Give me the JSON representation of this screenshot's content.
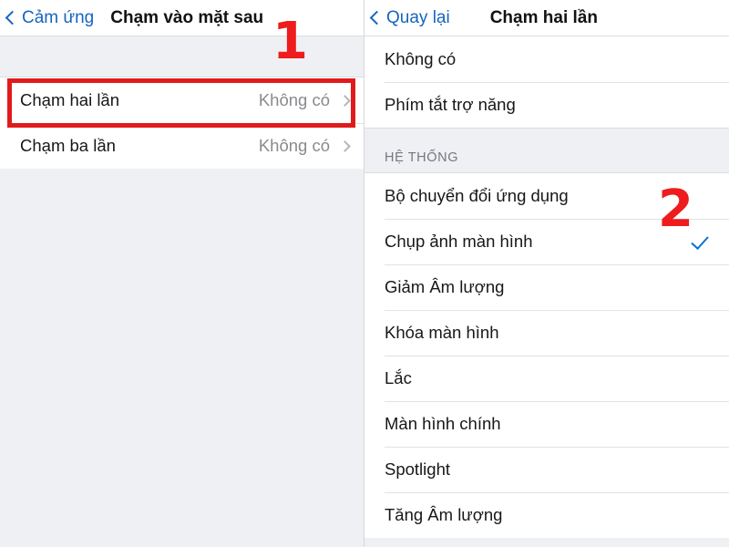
{
  "left_panel": {
    "navbar": {
      "back_label": "Cảm ứng",
      "back_icon": "chevron-left-icon",
      "title": "Chạm vào mặt sau"
    },
    "rows": [
      {
        "label": "Chạm hai lần",
        "value": "Không có",
        "chevron": "chevron-right-icon",
        "highlighted": true
      },
      {
        "label": "Chạm ba lần",
        "value": "Không có",
        "chevron": "chevron-right-icon",
        "highlighted": false
      }
    ]
  },
  "right_panel": {
    "navbar": {
      "back_label": "Quay lại",
      "back_icon": "chevron-left-icon",
      "title": "Chạm hai lần"
    },
    "top_rows": [
      {
        "label": "Không có",
        "selected": false
      },
      {
        "label": "Phím tắt trợ năng",
        "selected": false
      }
    ],
    "section_title": "HỆ THỐNG",
    "system_rows": [
      {
        "label": "Bộ chuyển đổi ứng dụng",
        "selected": false
      },
      {
        "label": "Chụp ảnh màn hình",
        "selected": true
      },
      {
        "label": "Giảm Âm lượng",
        "selected": false
      },
      {
        "label": "Khóa màn hình",
        "selected": false
      },
      {
        "label": "Lắc",
        "selected": false
      },
      {
        "label": "Màn hình chính",
        "selected": false
      },
      {
        "label": "Spotlight",
        "selected": false
      },
      {
        "label": "Tăng Âm lượng",
        "selected": false
      }
    ],
    "check_icon": "checkmark-icon"
  },
  "annotations": {
    "step_one": "1",
    "step_two": "2",
    "color": "#ee1c1c"
  }
}
